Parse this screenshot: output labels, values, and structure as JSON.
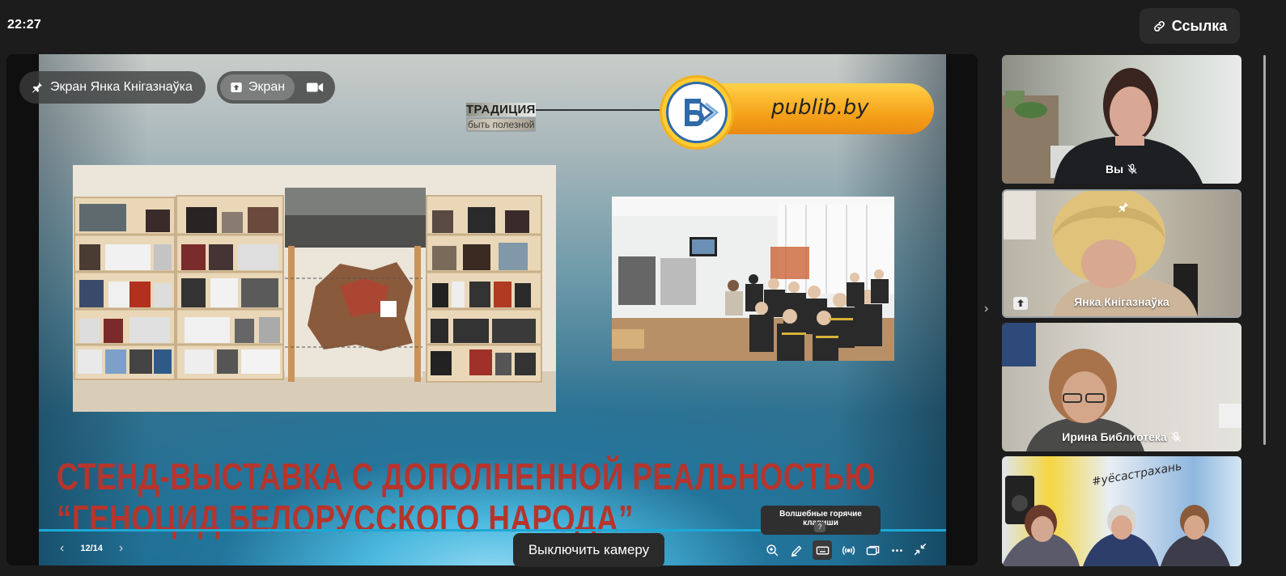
{
  "clock": "22:27",
  "link_button": "Ссылка",
  "stage": {
    "owner_label": "Экран Янка Кнiгазнаўка",
    "screen_label": "Экран"
  },
  "slide": {
    "tradition_title": "ТРАДИЦИЯ",
    "tradition_subtitle": "быть полезной",
    "brand": "publib.by",
    "headline_line1": "СТЕНД-ВЫСТАВКА С ДОПОЛНЕННОЙ РЕАЛЬНОСТЬЮ",
    "headline_line2": "“ГЕНОЦИД БЕЛОРУССКОГО НАРОДА”"
  },
  "controls": {
    "page_counter": "12/14",
    "camera_tooltip": "Выключить камеру",
    "magic_tooltip": "Волшебные горячие клавиши",
    "magic_key": "?"
  },
  "participants": [
    {
      "name": "Вы",
      "muted": true
    },
    {
      "name": "Янка Кнiгазнаўка",
      "muted": false,
      "pinned": true,
      "sharing": true
    },
    {
      "name": "Ирина Библиотека",
      "muted": true
    },
    {
      "name": "",
      "muted": false,
      "caption": "#уёсастрахань"
    }
  ],
  "colors": {
    "accent": "#1ca9d6",
    "headline": "#b5352d",
    "brand_bar": "#f6a21a"
  }
}
